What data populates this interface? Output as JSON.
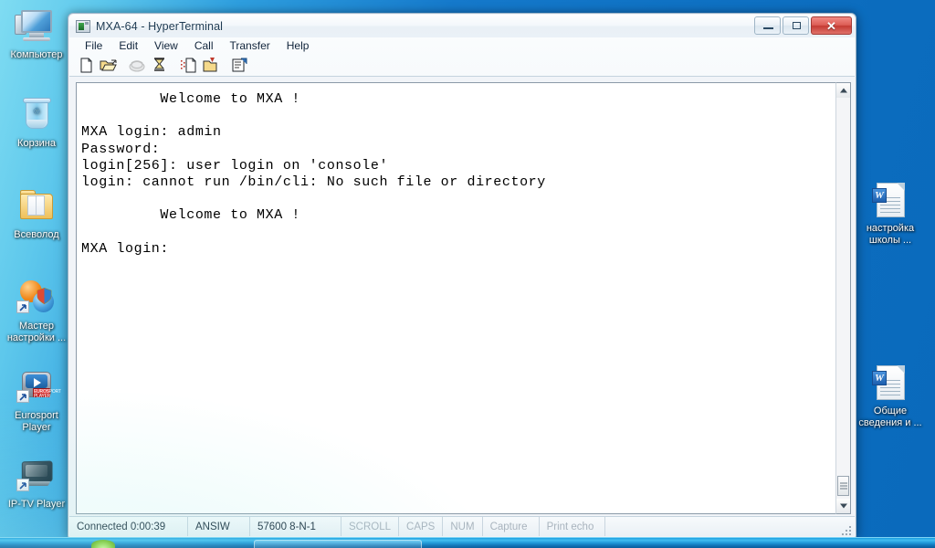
{
  "desktop": {
    "icons_left": [
      {
        "label": "Компьютер",
        "icon": "computer-icon",
        "name": "desktop-icon-computer"
      },
      {
        "label": "Корзина",
        "icon": "recycle-bin-icon",
        "name": "desktop-icon-recycle-bin"
      },
      {
        "label": "Всеволод",
        "icon": "folder-icon",
        "name": "desktop-icon-folder-vsevolod"
      },
      {
        "label": "Мастер\nнастройки ...",
        "icon": "setup-wizard-icon",
        "name": "desktop-icon-setup-wizard"
      },
      {
        "label": "Eurosport\nPlayer",
        "icon": "media-player-icon",
        "name": "desktop-icon-eurosport-player",
        "badge": "EUROSPORT PLAYER"
      },
      {
        "label": "IP-TV Player",
        "icon": "tv-player-icon",
        "name": "desktop-icon-iptv-player"
      }
    ],
    "icons_right": [
      {
        "label": "настройка\nшколы ...",
        "icon": "word-document-icon",
        "name": "desktop-icon-doc-school-setup",
        "glyph": "W"
      },
      {
        "label": "Общие\nсведения и ...",
        "icon": "word-document-icon",
        "name": "desktop-icon-doc-general-info",
        "glyph": "W"
      }
    ],
    "wallpaper_color": "#1579cb"
  },
  "window": {
    "title": "MXA-64 - HyperTerminal",
    "controls": {
      "minimize": "Minimize",
      "maximize": "Maximize",
      "close": "✕"
    },
    "menu": [
      {
        "label": "File",
        "name": "menu-file"
      },
      {
        "label": "Edit",
        "name": "menu-edit"
      },
      {
        "label": "View",
        "name": "menu-view"
      },
      {
        "label": "Call",
        "name": "menu-call"
      },
      {
        "label": "Transfer",
        "name": "menu-transfer"
      },
      {
        "label": "Help",
        "name": "menu-help"
      }
    ],
    "toolbar": [
      {
        "name": "new-connection-button",
        "icon": "new-page-icon",
        "title": "New"
      },
      {
        "name": "open-connection-button",
        "icon": "open-folder-icon",
        "title": "Open"
      },
      {
        "name": "call-button",
        "icon": "phone-icon",
        "title": "Call",
        "disabled": true
      },
      {
        "name": "disconnect-button",
        "icon": "phone-hangup-icon",
        "title": "Disconnect"
      },
      {
        "name": "send-file-button",
        "icon": "send-file-icon",
        "title": "Send"
      },
      {
        "name": "receive-file-button",
        "icon": "receive-file-icon",
        "title": "Receive"
      },
      {
        "name": "properties-button",
        "icon": "properties-icon",
        "title": "Properties"
      }
    ]
  },
  "terminal": {
    "text": "         Welcome to MXA !\n\nMXA login: admin\nPassword:\nlogin[256]: user login on 'console'\nlogin: cannot run /bin/cli: No such file or directory\n\n         Welcome to MXA !\n\nMXA login: ",
    "background": "#ffffff",
    "foreground": "#000000"
  },
  "statusbar": {
    "cells": [
      {
        "label": "Connected 0:00:39",
        "name": "status-connection-time",
        "dim": false
      },
      {
        "label": "ANSIW",
        "name": "status-emulation",
        "dim": false
      },
      {
        "label": "57600 8-N-1",
        "name": "status-line-settings",
        "dim": false
      },
      {
        "label": "SCROLL",
        "name": "status-scroll-lock",
        "dim": true
      },
      {
        "label": "CAPS",
        "name": "status-caps-lock",
        "dim": true
      },
      {
        "label": "NUM",
        "name": "status-num-lock",
        "dim": true
      },
      {
        "label": "Capture",
        "name": "status-capture",
        "dim": true
      },
      {
        "label": "Print echo",
        "name": "status-print-echo",
        "dim": true
      }
    ]
  }
}
